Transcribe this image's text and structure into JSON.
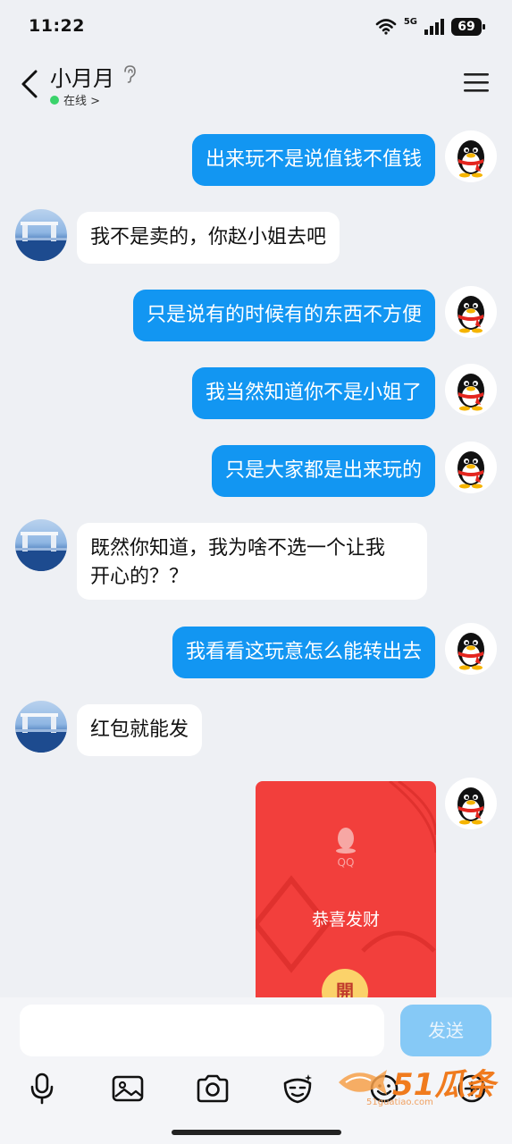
{
  "status_bar": {
    "time": "11:22",
    "network": "5G",
    "battery": "69"
  },
  "header": {
    "contact_name": "小月月",
    "presence": "在线 >"
  },
  "messages": [
    {
      "side": "right",
      "text": "出来玩不是说值钱不值钱"
    },
    {
      "side": "left",
      "text": "我不是卖的，你赵小姐去吧"
    },
    {
      "side": "right",
      "text": "只是说有的时候有的东西不方便"
    },
    {
      "side": "right",
      "text": "我当然知道你不是小姐了"
    },
    {
      "side": "right",
      "text": "只是大家都是出来玩的"
    },
    {
      "side": "left",
      "line1": "既然你知道，我为啥不选一个让我",
      "line2": "开心的？？"
    },
    {
      "side": "right",
      "text": "我看看这玩意怎么能转出去"
    },
    {
      "side": "left",
      "text": "红包就能发"
    }
  ],
  "red_packet": {
    "brand": "QQ",
    "greeting": "恭喜发财",
    "open_label": "開"
  },
  "composer": {
    "input_value": "",
    "send_label": "发送"
  },
  "toolbar": [
    "microphone-icon",
    "image-icon",
    "camera-icon",
    "sticker-icon",
    "emoji-icon",
    "add-icon"
  ],
  "watermark": {
    "logo": "51瓜条",
    "url": "51guatiao.com"
  },
  "colors": {
    "self_bubble": "#1296f2",
    "peer_bubble": "#ffffff",
    "red_packet": "#f23f3c",
    "online": "#3ad36b",
    "send_button": "#86c9f6"
  }
}
